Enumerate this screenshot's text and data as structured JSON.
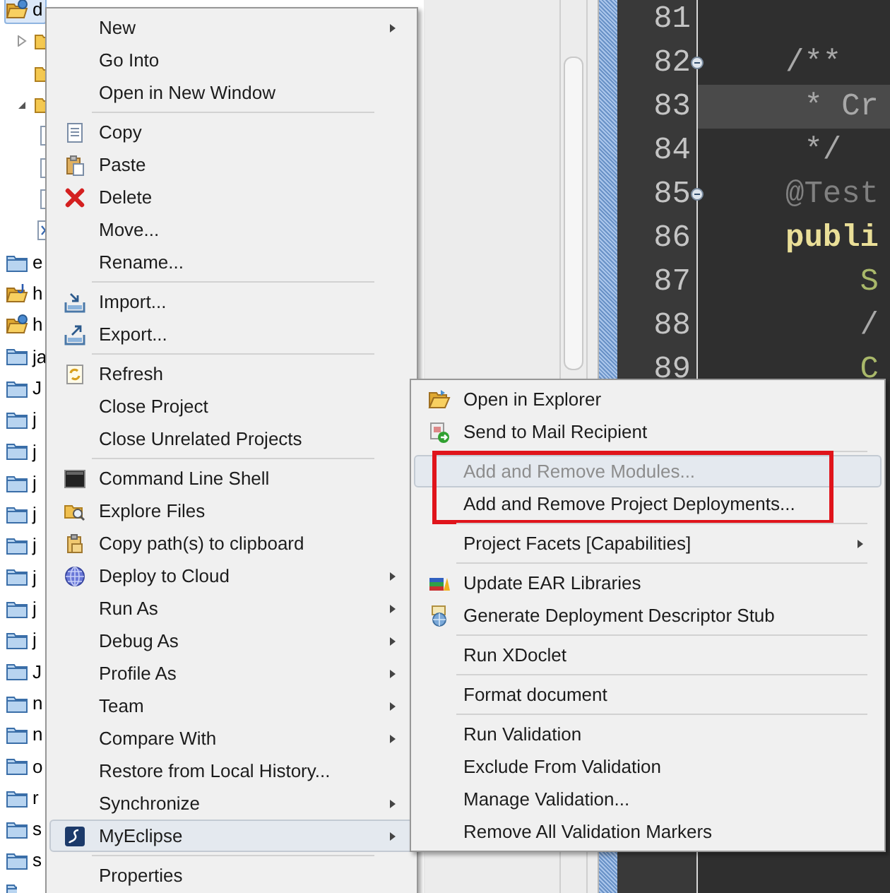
{
  "tree": [
    {
      "label": "d",
      "kind": "web-project",
      "selected": true,
      "children": [
        {
          "kind": "folder",
          "selected": false,
          "expanded": false
        },
        {
          "kind": "folder",
          "selected": false
        },
        {
          "kind": "folder",
          "selected": false,
          "expanded": true,
          "children": [
            {
              "kind": "file",
              "selected": false
            },
            {
              "kind": "file",
              "selected": false
            },
            {
              "kind": "file",
              "selected": false
            }
          ]
        },
        {
          "kind": "xml-file",
          "selected": false
        }
      ]
    },
    {
      "label": "e",
      "kind": "closed-project",
      "selected": false
    },
    {
      "label": "h",
      "kind": "java-project",
      "selected": false
    },
    {
      "label": "h",
      "kind": "web-project",
      "selected": false
    },
    {
      "label": "ja",
      "kind": "closed-project",
      "selected": false
    },
    {
      "label": "J",
      "kind": "closed-project",
      "selected": false
    },
    {
      "label": "j",
      "kind": "closed-project",
      "selected": false
    },
    {
      "label": "j",
      "kind": "closed-project",
      "selected": false
    },
    {
      "label": "j",
      "kind": "closed-project",
      "selected": false
    },
    {
      "label": "j",
      "kind": "closed-project",
      "selected": false
    },
    {
      "label": "j",
      "kind": "closed-project",
      "selected": false
    },
    {
      "label": "j",
      "kind": "closed-project",
      "selected": false
    },
    {
      "label": "j",
      "kind": "closed-project",
      "selected": false
    },
    {
      "label": "j",
      "kind": "closed-project",
      "selected": false
    },
    {
      "label": "J",
      "kind": "closed-project",
      "selected": false
    },
    {
      "label": "n",
      "kind": "closed-project",
      "selected": false
    },
    {
      "label": "n",
      "kind": "closed-project",
      "selected": false
    },
    {
      "label": "o",
      "kind": "closed-project",
      "selected": false
    },
    {
      "label": "r",
      "kind": "closed-project",
      "selected": false
    },
    {
      "label": "s",
      "kind": "closed-project",
      "selected": false
    },
    {
      "label": "s",
      "kind": "closed-project",
      "selected": false
    },
    {
      "kind": "closed-project",
      "selected": false
    }
  ],
  "editor": {
    "lines": [
      {
        "number": "81",
        "current": false,
        "foldable": false
      },
      {
        "number": "82",
        "code": "/**",
        "kind": "comment",
        "current": false,
        "foldable": true
      },
      {
        "number": "83",
        "code": " * Cr",
        "kind": "comment",
        "current": true,
        "foldable": false
      },
      {
        "number": "84",
        "code": " */",
        "kind": "comment",
        "current": false,
        "foldable": false
      },
      {
        "number": "85",
        "code": "@Test",
        "kind": "annotation",
        "current": false,
        "foldable": true
      },
      {
        "number": "86",
        "code": "publi",
        "kind": "keyword",
        "current": false,
        "foldable": false
      },
      {
        "number": "87",
        "code": "    S",
        "kind": "identifier",
        "current": false,
        "foldable": false
      },
      {
        "number": "88",
        "code": "    /",
        "kind": "comment",
        "current": false,
        "foldable": false
      },
      {
        "number": "89",
        "code": "    C",
        "kind": "identifier",
        "current": false,
        "foldable": false
      }
    ]
  },
  "context_menu": {
    "items": [
      {
        "kind": "item",
        "label": "New",
        "selected": false,
        "disabled": false,
        "submenu": true
      },
      {
        "kind": "item",
        "label": "Go Into",
        "selected": false,
        "disabled": false,
        "submenu": false
      },
      {
        "kind": "item",
        "label": "Open in New Window",
        "selected": false,
        "disabled": false,
        "submenu": false
      },
      {
        "kind": "separator"
      },
      {
        "kind": "item",
        "label": "Copy",
        "selected": false,
        "disabled": false,
        "submenu": false
      },
      {
        "kind": "item",
        "label": "Paste",
        "selected": false,
        "disabled": false,
        "submenu": false
      },
      {
        "kind": "item",
        "label": "Delete",
        "selected": false,
        "disabled": false,
        "submenu": false
      },
      {
        "kind": "item",
        "label": "Move...",
        "selected": false,
        "disabled": false,
        "submenu": false
      },
      {
        "kind": "item",
        "label": "Rename...",
        "selected": false,
        "disabled": false,
        "submenu": false
      },
      {
        "kind": "separator"
      },
      {
        "kind": "item",
        "label": "Import...",
        "selected": false,
        "disabled": false,
        "submenu": false
      },
      {
        "kind": "item",
        "label": "Export...",
        "selected": false,
        "disabled": false,
        "submenu": false
      },
      {
        "kind": "separator"
      },
      {
        "kind": "item",
        "label": "Refresh",
        "selected": false,
        "disabled": false,
        "submenu": false
      },
      {
        "kind": "item",
        "label": "Close Project",
        "selected": false,
        "disabled": false,
        "submenu": false
      },
      {
        "kind": "item",
        "label": "Close Unrelated Projects",
        "selected": false,
        "disabled": false,
        "submenu": false
      },
      {
        "kind": "separator"
      },
      {
        "kind": "item",
        "label": "Command Line Shell",
        "selected": false,
        "disabled": false,
        "submenu": false
      },
      {
        "kind": "item",
        "label": "Explore Files",
        "selected": false,
        "disabled": false,
        "submenu": false
      },
      {
        "kind": "item",
        "label": "Copy path(s) to clipboard",
        "selected": false,
        "disabled": false,
        "submenu": false
      },
      {
        "kind": "item",
        "label": "Deploy to Cloud",
        "selected": false,
        "disabled": false,
        "submenu": true
      },
      {
        "kind": "item",
        "label": "Run As",
        "selected": false,
        "disabled": false,
        "submenu": true
      },
      {
        "kind": "item",
        "label": "Debug As",
        "selected": false,
        "disabled": false,
        "submenu": true
      },
      {
        "kind": "item",
        "label": "Profile As",
        "selected": false,
        "disabled": false,
        "submenu": true
      },
      {
        "kind": "item",
        "label": "Team",
        "selected": false,
        "disabled": false,
        "submenu": true
      },
      {
        "kind": "item",
        "label": "Compare With",
        "selected": false,
        "disabled": false,
        "submenu": true
      },
      {
        "kind": "item",
        "label": "Restore from Local History...",
        "selected": false,
        "disabled": false,
        "submenu": false
      },
      {
        "kind": "item",
        "label": "Synchronize",
        "selected": false,
        "disabled": false,
        "submenu": true
      },
      {
        "kind": "item",
        "label": "MyEclipse",
        "selected": true,
        "disabled": false,
        "submenu": true
      },
      {
        "kind": "separator"
      },
      {
        "kind": "item",
        "label": "Properties",
        "selected": false,
        "disabled": false,
        "submenu": false
      }
    ]
  },
  "submenu": {
    "items": [
      {
        "kind": "item",
        "label": "Open in Explorer",
        "selected": false,
        "disabled": false,
        "submenu": false,
        "framed": false
      },
      {
        "kind": "item",
        "label": "Send to Mail Recipient",
        "selected": false,
        "disabled": false,
        "submenu": false,
        "framed": false
      },
      {
        "kind": "separator"
      },
      {
        "kind": "item",
        "label": "Add and Remove Modules...",
        "selected": true,
        "disabled": true,
        "submenu": false,
        "framed": true
      },
      {
        "kind": "item",
        "label": "Add and Remove Project Deployments...",
        "selected": false,
        "disabled": false,
        "submenu": false,
        "framed": true
      },
      {
        "kind": "separator"
      },
      {
        "kind": "item",
        "label": "Project Facets [Capabilities]",
        "selected": false,
        "disabled": false,
        "submenu": true,
        "framed": false
      },
      {
        "kind": "separator"
      },
      {
        "kind": "item",
        "label": "Update EAR Libraries",
        "selected": false,
        "disabled": false,
        "submenu": false,
        "framed": false
      },
      {
        "kind": "item",
        "label": "Generate Deployment Descriptor Stub",
        "selected": false,
        "disabled": false,
        "submenu": false,
        "framed": false
      },
      {
        "kind": "separator"
      },
      {
        "kind": "item",
        "label": "Run XDoclet",
        "selected": false,
        "disabled": false,
        "submenu": false,
        "framed": false
      },
      {
        "kind": "separator"
      },
      {
        "kind": "item",
        "label": "Format document",
        "selected": false,
        "disabled": false,
        "submenu": false,
        "framed": false
      },
      {
        "kind": "separator"
      },
      {
        "kind": "item",
        "label": "Run Validation",
        "selected": false,
        "disabled": false,
        "submenu": false,
        "framed": false
      },
      {
        "kind": "item",
        "label": "Exclude From Validation",
        "selected": false,
        "disabled": false,
        "submenu": false,
        "framed": false
      },
      {
        "kind": "item",
        "label": "Manage Validation...",
        "selected": false,
        "disabled": false,
        "submenu": false,
        "framed": false
      },
      {
        "kind": "item",
        "label": "Remove All Validation Markers",
        "selected": false,
        "disabled": false,
        "submenu": false,
        "framed": false
      }
    ]
  }
}
